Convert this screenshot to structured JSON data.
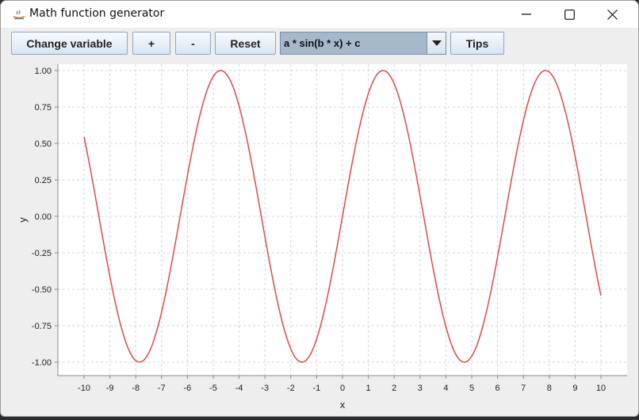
{
  "window": {
    "title": "Math function generator",
    "controls": {
      "minimize": "minimize-icon",
      "maximize": "maximize-icon",
      "close": "close-icon"
    }
  },
  "toolbar": {
    "change_variable_label": "Change variable",
    "plus_label": "+",
    "minus_label": "-",
    "reset_label": "Reset",
    "function_selected": "a * sin(b * x) + c",
    "tips_label": "Tips"
  },
  "colors": {
    "series": "#e0494a",
    "grid": "#d4d4d4",
    "background": "#eeeeee",
    "combo_bg": "#a6b8cc"
  },
  "chart_data": {
    "type": "line",
    "title": "",
    "xlabel": "x",
    "ylabel": "y",
    "xlim": [
      -10,
      10
    ],
    "ylim": [
      -1,
      1
    ],
    "x_ticks": [
      -10,
      -9,
      -8,
      -7,
      -6,
      -5,
      -4,
      -3,
      -2,
      -1,
      0,
      1,
      2,
      3,
      4,
      5,
      6,
      7,
      8,
      9,
      10
    ],
    "y_ticks": [
      "-1.00",
      "-0.75",
      "-0.50",
      "-0.25",
      "0.00",
      "0.25",
      "0.50",
      "0.75",
      "1.00"
    ],
    "grid": true,
    "series": [
      {
        "function": "sin(x)",
        "x": [
          -10,
          -9.5,
          -9,
          -8.5,
          -8,
          -7.5,
          -7,
          -6.5,
          -6,
          -5.5,
          -5,
          -4.5,
          -4,
          -3.5,
          -3,
          -2.5,
          -2,
          -1.5,
          -1,
          -0.5,
          0,
          0.5,
          1,
          1.5,
          2,
          2.5,
          3,
          3.5,
          4,
          4.5,
          5,
          5.5,
          6,
          6.5,
          7,
          7.5,
          8,
          8.5,
          9,
          9.5,
          10
        ],
        "y": [
          0.544,
          0.075,
          -0.412,
          -0.798,
          -0.989,
          -0.938,
          -0.657,
          -0.215,
          0.279,
          0.706,
          0.959,
          0.978,
          0.757,
          0.351,
          -0.141,
          -0.598,
          -0.909,
          -0.997,
          -0.841,
          -0.479,
          0.0,
          0.479,
          0.841,
          0.997,
          0.909,
          0.598,
          0.141,
          -0.351,
          -0.757,
          -0.978,
          -0.959,
          -0.706,
          -0.279,
          0.215,
          0.657,
          0.938,
          0.989,
          0.798,
          0.412,
          -0.075,
          -0.544
        ]
      }
    ]
  }
}
